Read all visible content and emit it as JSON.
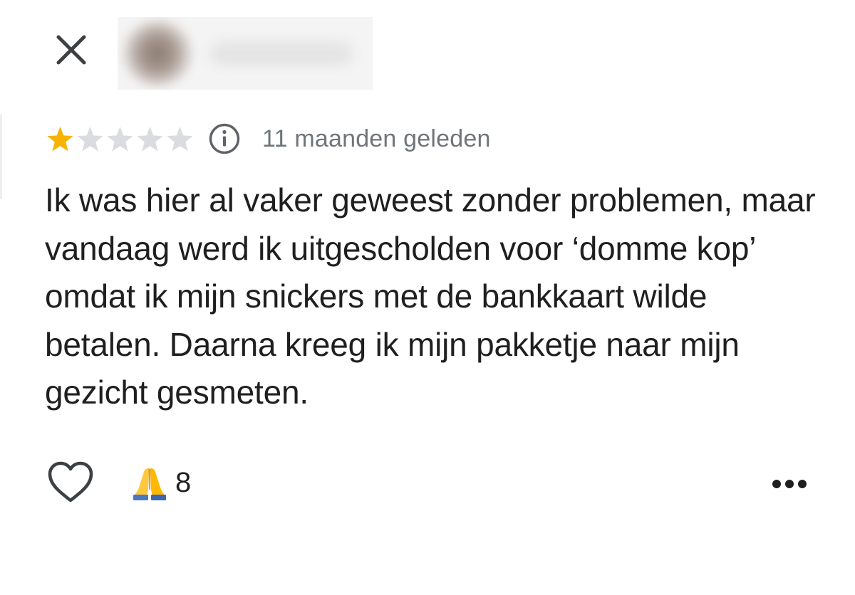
{
  "header": {
    "close_icon": "close-icon",
    "reviewer_blurred": true
  },
  "review": {
    "rating": 1,
    "max_rating": 5,
    "star_filled_color": "#f6b400",
    "star_empty_color": "#dadce0",
    "info_icon": "info-icon",
    "time_ago": "11 maanden geleden",
    "text": "Ik was hier al vaker geweest zonder problemen, maar vandaag werd ik uitgescholden voor ‘domme kop’ omdat ik mijn snickers met de bankkaart wilde betalen. Daarna kreeg ik mijn pakketje naar mijn gezicht gesmeten."
  },
  "actions": {
    "like_icon": "heart-outline-icon",
    "reaction_icon": "folded-hands-emoji",
    "reaction_count": "8",
    "more_icon": "more-horizontal-icon"
  }
}
